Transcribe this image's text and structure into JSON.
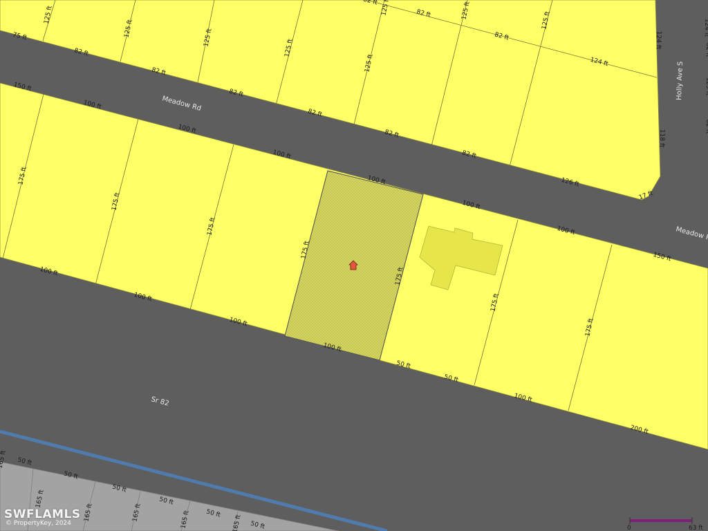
{
  "roads": {
    "meadow_rd": "Meadow Rd",
    "meadow_rd_right": "Meadow R",
    "holly_ave": "Holly Ave S",
    "sr82": "Sr 82"
  },
  "watermark": {
    "brand": "SWFLAMLS",
    "copyright": "© PropertyKey, 2024"
  },
  "scale": {
    "start": "0",
    "end": "63 ft"
  },
  "colors": {
    "parcel": "#ffff66",
    "subject_parcel": "#cfd05a",
    "building": "#e6e64a",
    "road": "#5e5e5e",
    "canal": "#4f7cad",
    "marker": "#e2573b"
  },
  "dimension_labels": [
    "82 ft",
    "125 ft",
    "125 ft",
    "125 ft",
    "125 ft",
    "125 ft",
    "82 ft",
    "125 ft",
    "82 ft",
    "125 ft",
    "124 ft",
    "124 ft",
    "75 ft",
    "82 ft",
    "82 ft",
    "82 ft",
    "82 ft",
    "82 ft",
    "82 ft",
    "124 ft",
    "126 ft",
    "17 ft",
    "118 ft",
    "150 ft",
    "100 ft",
    "100 ft",
    "100 ft",
    "100 ft",
    "100 ft",
    "100 ft",
    "150 ft",
    "175 ft",
    "175 ft",
    "175 ft",
    "175 ft",
    "175 ft",
    "175 ft",
    "175 ft",
    "100 ft",
    "100 ft",
    "100 ft",
    "100 ft",
    "50 ft",
    "50 ft",
    "100 ft",
    "200 ft",
    "50 ft",
    "50 ft",
    "50 ft",
    "50 ft",
    "50 ft",
    "50 ft",
    "165 ft",
    "165 ft",
    "165 ft",
    "165 ft",
    "165 ft",
    "165 ft",
    "125 ft",
    "82 ft",
    "125 ft",
    "82 ft"
  ]
}
